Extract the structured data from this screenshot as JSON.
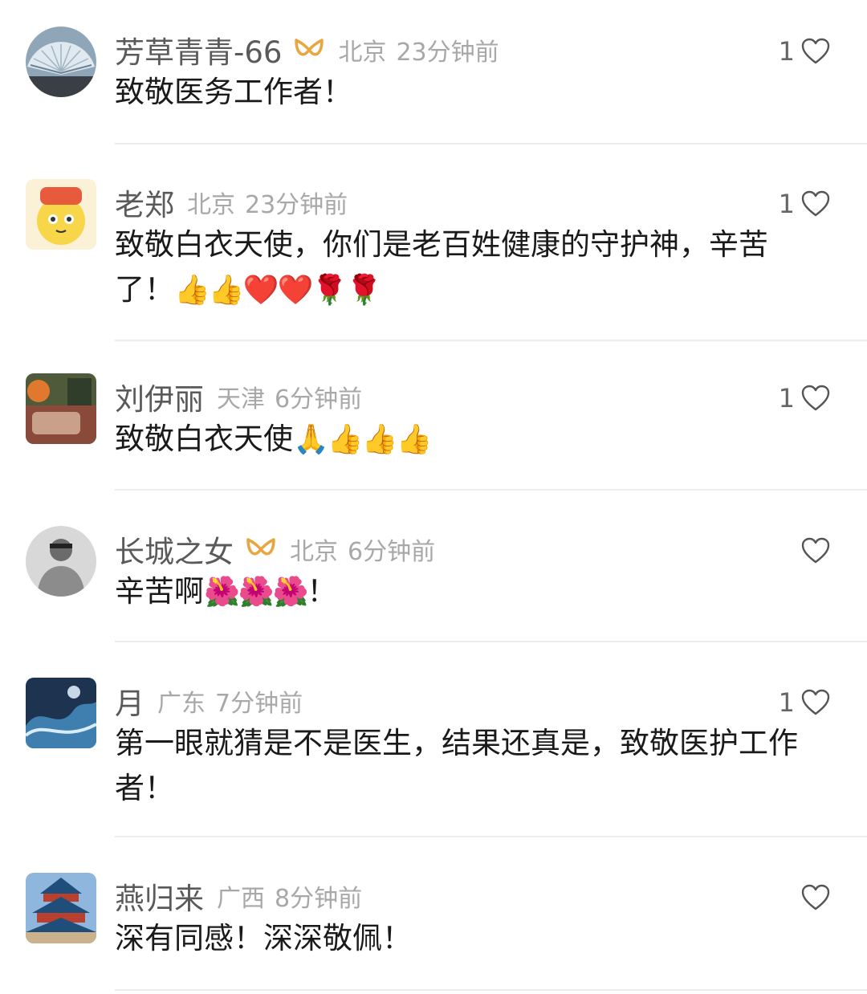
{
  "comments": [
    {
      "username": "芳草青青-66",
      "badge": true,
      "location": "北京",
      "time": "23分钟前",
      "likes": "1",
      "text": "致敬医务工作者！",
      "emoji": ""
    },
    {
      "username": "老郑",
      "badge": false,
      "location": "北京",
      "time": "23分钟前",
      "likes": "1",
      "text": "致敬白衣天使，你们是老百姓健康的守护神，辛苦了！",
      "emoji": "👍👍❤️❤️🌹🌹"
    },
    {
      "username": "刘伊丽",
      "badge": false,
      "location": "天津",
      "time": "6分钟前",
      "likes": "1",
      "text": "致敬白衣天使",
      "emoji": "🙏👍👍👍"
    },
    {
      "username": "长城之女",
      "badge": true,
      "location": "北京",
      "time": "6分钟前",
      "likes": "",
      "text": "辛苦啊",
      "emoji": "🌺🌺🌺",
      "text_tail": "！"
    },
    {
      "username": "月",
      "badge": false,
      "location": "广东",
      "time": "7分钟前",
      "likes": "1",
      "text": "第一眼就猜是不是医生，结果还真是，致敬医护工作者！",
      "emoji": ""
    },
    {
      "username": "燕归来",
      "badge": false,
      "location": "广西",
      "time": "8分钟前",
      "likes": "",
      "text": "深有同感！深深敬佩！",
      "emoji": ""
    }
  ],
  "colors": {
    "username": "#5a5a5a",
    "meta": "#a8a8a8",
    "badge": "#e8a640",
    "divider": "#ececec"
  }
}
